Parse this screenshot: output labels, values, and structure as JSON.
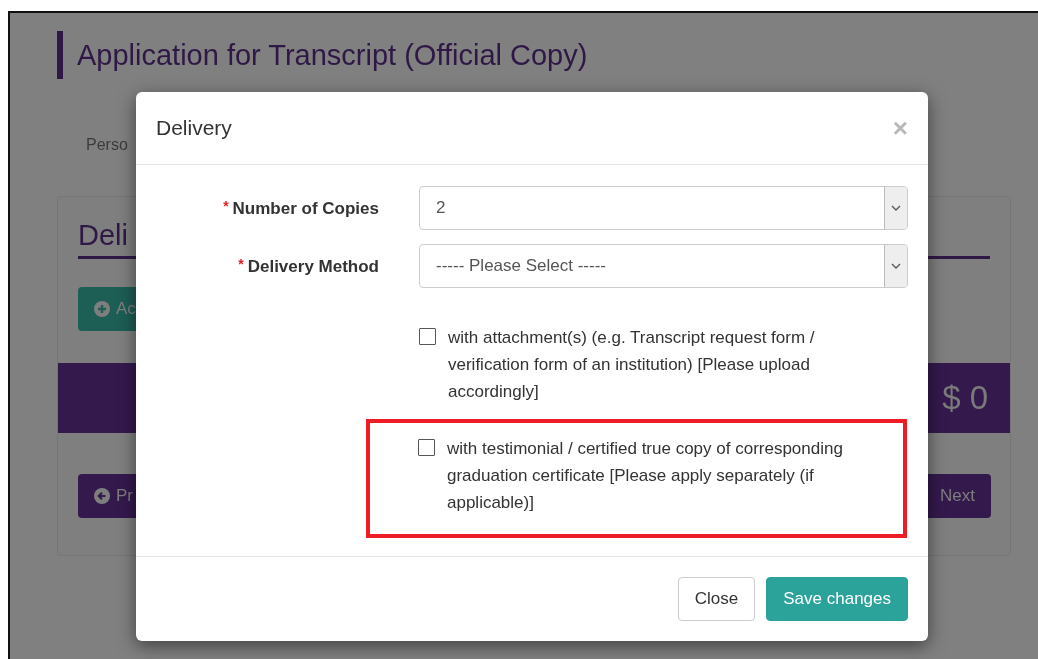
{
  "page": {
    "title": "Application for Transcript (Official Copy)",
    "tab_label": "Perso",
    "section_heading": "Deli",
    "add_button": "Ac",
    "total": "$ 0",
    "prev_button": "Pr",
    "next_button": "Next"
  },
  "dialog": {
    "title": "Delivery",
    "close_icon": "×",
    "fields": [
      {
        "label": "Number of Copies",
        "required_mark": "*",
        "value": "2"
      },
      {
        "label": "Delivery Method",
        "required_mark": "*",
        "value": "----- Please Select -----"
      }
    ],
    "options": [
      {
        "label": "with attachment(s) (e.g. Transcript request form / verification form of an institution) [Please upload accordingly]",
        "checked": false,
        "highlighted": false
      },
      {
        "label": "with testimonial / certified true copy of corresponding graduation certificate [Please apply separately (if applicable)]",
        "checked": false,
        "highlighted": true
      }
    ],
    "buttons": [
      {
        "label": "Close",
        "kind": "default"
      },
      {
        "label": "Save changes",
        "kind": "primary"
      }
    ]
  }
}
